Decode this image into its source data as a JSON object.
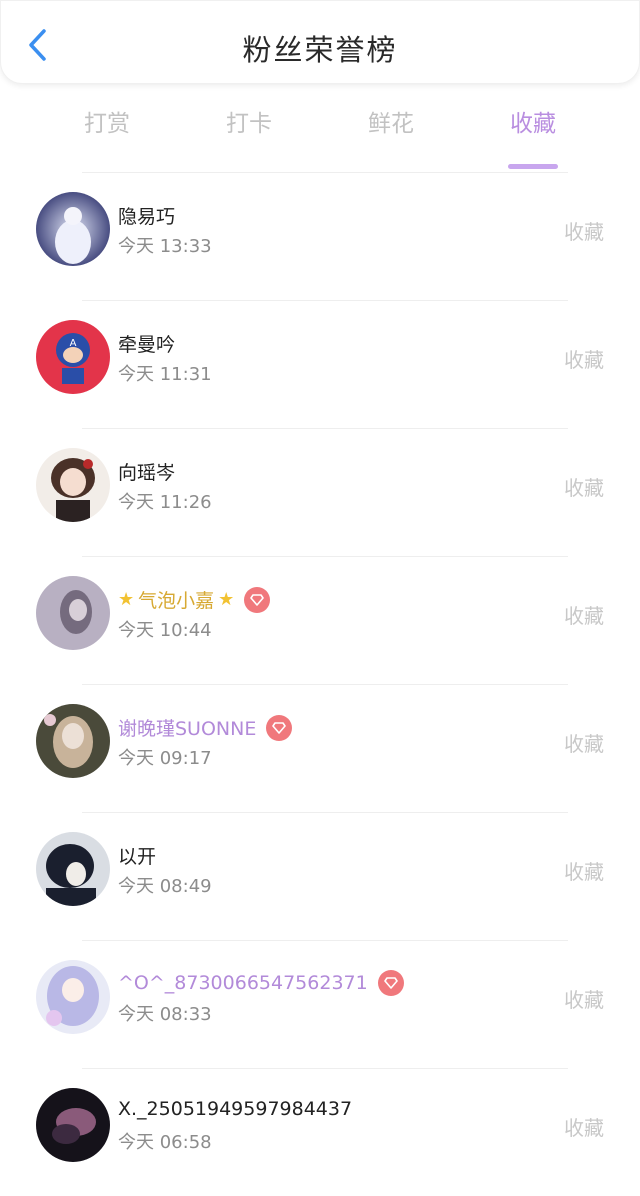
{
  "header": {
    "title": "粉丝荣誉榜"
  },
  "tabs": [
    {
      "label": "打赏",
      "active": false
    },
    {
      "label": "打卡",
      "active": false
    },
    {
      "label": "鲜花",
      "active": false
    },
    {
      "label": "收藏",
      "active": true
    }
  ],
  "colors": {
    "accent": "#b98ee0",
    "back_icon": "#3b8ff0",
    "vip_badge": "#f0787c",
    "inactive_text": "#c2c2c2"
  },
  "rows": [
    {
      "name": "隐易巧",
      "time": "今天 13:33",
      "action": "收藏",
      "style": "normal",
      "vip": false
    },
    {
      "name": "牵曼吟",
      "time": "今天 11:31",
      "action": "收藏",
      "style": "normal",
      "vip": false
    },
    {
      "name": "向瑶岑",
      "time": "今天 11:26",
      "action": "收藏",
      "style": "normal",
      "vip": false
    },
    {
      "name": "气泡小嘉",
      "time": "今天 10:44",
      "action": "收藏",
      "style": "gold",
      "vip": true,
      "decor": "star-icon"
    },
    {
      "name": "谢晚瑾SUONNE",
      "time": "今天 09:17",
      "action": "收藏",
      "style": "vip",
      "vip": true
    },
    {
      "name": "以开",
      "time": "今天 08:49",
      "action": "收藏",
      "style": "normal",
      "vip": false
    },
    {
      "name": "^O^_8730066547562371",
      "time": "今天 08:33",
      "action": "收藏",
      "style": "vip",
      "vip": true
    },
    {
      "name": "X._25051949597984437",
      "time": "今天 06:58",
      "action": "收藏",
      "style": "normal",
      "vip": false
    }
  ]
}
